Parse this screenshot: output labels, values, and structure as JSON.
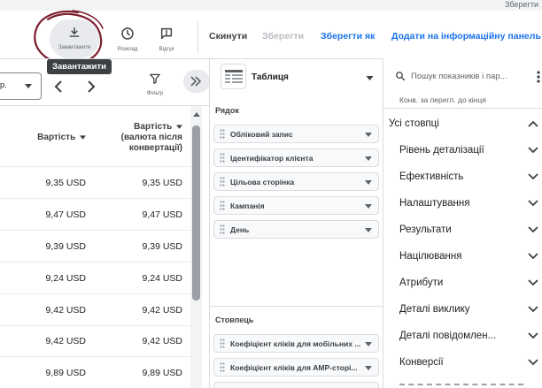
{
  "topstrip": {
    "label": "Зберегти"
  },
  "toolbar": {
    "download": {
      "label": "Завантажити"
    },
    "schedule": {
      "label": "Розклад"
    },
    "feedback": {
      "label": "Відгук"
    },
    "reset": "Скинути",
    "save": "Зберегти",
    "save_as": "Зберегти як",
    "add_to_panel": "Додати на інформаційну панель",
    "tooltip": "Завантажити"
  },
  "date_row": {
    "date_value": "р.",
    "filter_label": "Фільтр"
  },
  "table": {
    "headers": [
      {
        "lines": [
          "Вартість"
        ]
      },
      {
        "lines": [
          "Вартість",
          "(валюта після",
          "конвертації)"
        ]
      }
    ],
    "rows": [
      [
        "9,35 USD",
        "9,35 USD"
      ],
      [
        "9,47 USD",
        "9,47 USD"
      ],
      [
        "9,39 USD",
        "9,39 USD"
      ],
      [
        "9,24 USD",
        "9,24 USD"
      ],
      [
        "9,42 USD",
        "9,42 USD"
      ],
      [
        "9,42 USD",
        "9,42 USD"
      ],
      [
        "9,89 USD",
        "9,89 USD"
      ]
    ]
  },
  "editor": {
    "view_type": "Таблиця",
    "rows_title": "Рядок",
    "rows": [
      "Обліковий запис",
      "Ідентифікатор клієнта",
      "Цільова сторінка",
      "Кампанія",
      "День"
    ],
    "columns_title": "Стовпець",
    "columns": [
      "Коефіцієнт кліків для мобільних ...",
      "Коефіцієнт кліків для AMP-сторі..."
    ]
  },
  "metrics_panel": {
    "search_placeholder": "Пошук показників і пар...",
    "partial_item": "Конв. за перегл. до кінця",
    "all_columns": "Усі стовпці",
    "categories": [
      "Рівень деталізації",
      "Ефективність",
      "Налаштування",
      "Результати",
      "Націлювання",
      "Атрибути",
      "Деталі виклику",
      "Деталі повідомлен...",
      "Конверсії"
    ]
  }
}
